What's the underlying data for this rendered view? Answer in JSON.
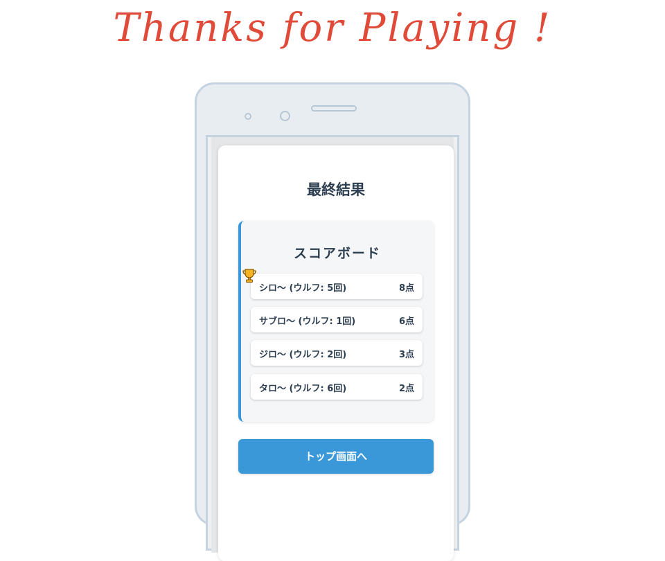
{
  "headline": "Thanks for Playing !",
  "result": {
    "title": "最終結果",
    "scoreboard_title": "スコアボード",
    "rows": [
      {
        "name": "シロ〜 (ウルフ: 5回)",
        "score": "8点",
        "winner": true
      },
      {
        "name": "サブロ〜 (ウルフ: 1回)",
        "score": "6点",
        "winner": false
      },
      {
        "name": "ジロ〜 (ウルフ: 2回)",
        "score": "3点",
        "winner": false
      },
      {
        "name": "タロ〜 (ウルフ: 6回)",
        "score": "2点",
        "winner": false
      }
    ],
    "top_button_label": "トップ画面へ"
  },
  "icons": {
    "winner": "trophy-icon"
  },
  "colors": {
    "headline": "#e04a38",
    "accent": "#3a98d8",
    "text": "#2c3e50"
  }
}
